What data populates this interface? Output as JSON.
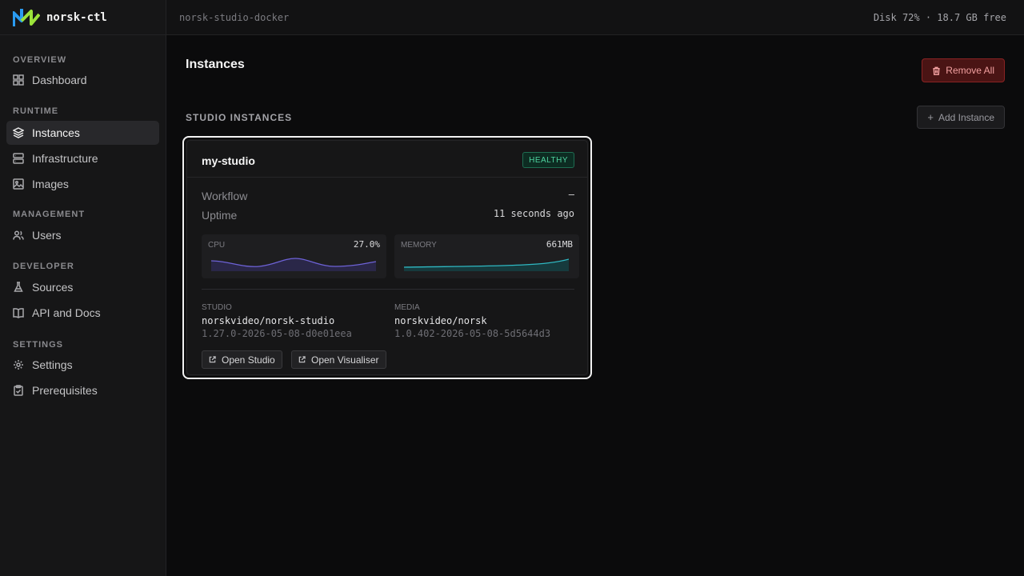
{
  "brand": {
    "name": "norsk-ctl",
    "logo_icon": "norsk-logo-icon"
  },
  "sidebar": {
    "sections": [
      {
        "label": "OVERVIEW",
        "items": [
          {
            "label": "Dashboard",
            "icon": "grid-icon"
          }
        ]
      },
      {
        "label": "RUNTIME",
        "items": [
          {
            "label": "Instances",
            "icon": "layers-icon",
            "active": true
          },
          {
            "label": "Infrastructure",
            "icon": "server-icon"
          },
          {
            "label": "Images",
            "icon": "image-icon"
          }
        ]
      },
      {
        "label": "MANAGEMENT",
        "items": [
          {
            "label": "Users",
            "icon": "users-icon"
          }
        ]
      },
      {
        "label": "DEVELOPER",
        "items": [
          {
            "label": "Sources",
            "icon": "flask-icon"
          },
          {
            "label": "API and Docs",
            "icon": "book-icon"
          }
        ]
      },
      {
        "label": "SETTINGS",
        "items": [
          {
            "label": "Settings",
            "icon": "gear-icon"
          },
          {
            "label": "Prerequisites",
            "icon": "clipboard-check-icon"
          }
        ]
      }
    ]
  },
  "topbar": {
    "context": "norsk-studio-docker",
    "disk": "Disk 72% · 18.7 GB free"
  },
  "page": {
    "title": "Instances",
    "remove_all_label": "Remove All",
    "section_label": "STUDIO INSTANCES",
    "add_instance_label": "Add Instance"
  },
  "instance": {
    "name": "my-studio",
    "status": "HEALTHY",
    "workflow_label": "Workflow",
    "workflow_value": "–",
    "uptime_label": "Uptime",
    "uptime_value": "11 seconds ago",
    "cpu": {
      "label": "CPU",
      "value": "27.0%"
    },
    "memory": {
      "label": "MEMORY",
      "value": "661MB"
    },
    "studio_image": {
      "label": "STUDIO",
      "name": "norskvideo/norsk-studio",
      "version": "1.27.0-2026-05-08-d0e01eea"
    },
    "media_image": {
      "label": "MEDIA",
      "name": "norskvideo/norsk",
      "version": "1.0.402-2026-05-08-5d5644d3"
    },
    "open_studio_label": "Open Studio",
    "open_visualiser_label": "Open Visualiser"
  },
  "colors": {
    "accent_green": "#4fd39f",
    "danger": "#8a2323",
    "cpu_line": "#6d62d6",
    "memory_line": "#2fb8c2"
  }
}
